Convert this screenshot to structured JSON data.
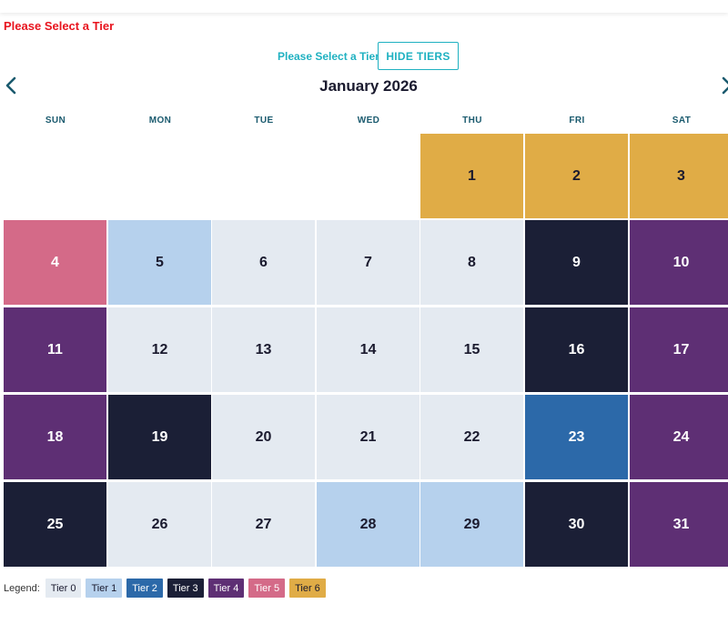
{
  "error_message": "Please Select a Tier",
  "tier_prompt": "Please Select a Tier",
  "hide_tiers_label": "HIDE TIERS",
  "month_title": "January 2026",
  "nav": {
    "prev_icon": "chevron-left-icon",
    "next_icon": "chevron-right-icon"
  },
  "weekdays": [
    "SUN",
    "MON",
    "TUE",
    "WED",
    "THU",
    "FRI",
    "SAT"
  ],
  "weeks": [
    [
      null,
      null,
      null,
      null,
      {
        "day": "1",
        "tier": 6
      },
      {
        "day": "2",
        "tier": 6
      },
      {
        "day": "3",
        "tier": 6
      }
    ],
    [
      {
        "day": "4",
        "tier": 5
      },
      {
        "day": "5",
        "tier": 1
      },
      {
        "day": "6",
        "tier": 0
      },
      {
        "day": "7",
        "tier": 0
      },
      {
        "day": "8",
        "tier": 0
      },
      {
        "day": "9",
        "tier": 3
      },
      {
        "day": "10",
        "tier": 4
      }
    ],
    [
      {
        "day": "11",
        "tier": 4
      },
      {
        "day": "12",
        "tier": 0
      },
      {
        "day": "13",
        "tier": 0
      },
      {
        "day": "14",
        "tier": 0
      },
      {
        "day": "15",
        "tier": 0
      },
      {
        "day": "16",
        "tier": 3
      },
      {
        "day": "17",
        "tier": 4
      }
    ],
    [
      {
        "day": "18",
        "tier": 4
      },
      {
        "day": "19",
        "tier": 3
      },
      {
        "day": "20",
        "tier": 0
      },
      {
        "day": "21",
        "tier": 0
      },
      {
        "day": "22",
        "tier": 0
      },
      {
        "day": "23",
        "tier": 2
      },
      {
        "day": "24",
        "tier": 4
      }
    ],
    [
      {
        "day": "25",
        "tier": 3
      },
      {
        "day": "26",
        "tier": 0
      },
      {
        "day": "27",
        "tier": 0
      },
      {
        "day": "28",
        "tier": 1
      },
      {
        "day": "29",
        "tier": 1
      },
      {
        "day": "30",
        "tier": 3
      },
      {
        "day": "31",
        "tier": 4
      }
    ]
  ],
  "legend": {
    "label": "Legend:",
    "tiers": [
      {
        "label": "Tier 0",
        "tier": 0
      },
      {
        "label": "Tier 1",
        "tier": 1
      },
      {
        "label": "Tier 2",
        "tier": 2
      },
      {
        "label": "Tier 3",
        "tier": 3
      },
      {
        "label": "Tier 4",
        "tier": 4
      },
      {
        "label": "Tier 5",
        "tier": 5
      },
      {
        "label": "Tier 6",
        "tier": 6
      }
    ]
  },
  "colors": {
    "tier0": "#e4eaf1",
    "tier1": "#b6d1ed",
    "tier2": "#2c69a9",
    "tier3": "#1b1f36",
    "tier4": "#5e2f74",
    "tier5": "#d46a88",
    "tier6": "#e0ac46",
    "accent": "#1fb1c1",
    "error": "#e8141e"
  }
}
